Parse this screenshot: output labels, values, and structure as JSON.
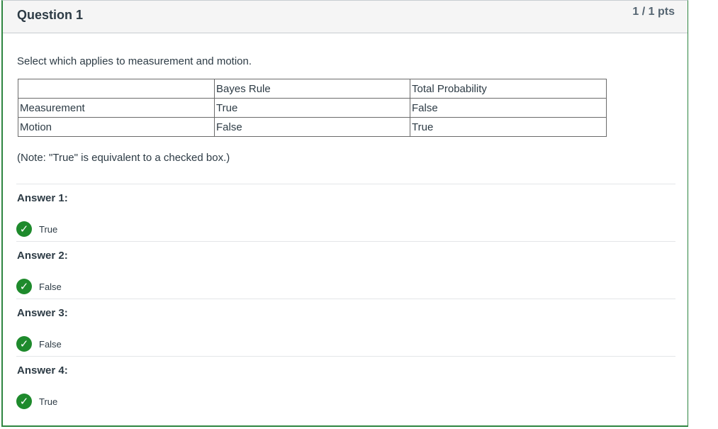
{
  "question": {
    "title": "Question 1",
    "points": "1 / 1 pts",
    "text": "Select which applies to measurement and motion.",
    "note": "(Note: \"True\" is equivalent to a checked box.)"
  },
  "table": {
    "header": [
      "",
      "Bayes Rule",
      "Total Probability"
    ],
    "rows": [
      [
        "Measurement",
        "True",
        "False"
      ],
      [
        "Motion",
        "False",
        "True"
      ]
    ]
  },
  "answers": [
    {
      "label": "Answer 1:",
      "value": "True",
      "status": "correct"
    },
    {
      "label": "Answer 2:",
      "value": "False",
      "status": "correct"
    },
    {
      "label": "Answer 3:",
      "value": "False",
      "status": "correct"
    },
    {
      "label": "Answer 4:",
      "value": "True",
      "status": "correct"
    }
  ],
  "colors": {
    "correct": "#1e8a2c",
    "border_correct": "#2e8540",
    "header_bg": "#f5f5f5"
  },
  "icons": {
    "correct": "check-icon"
  }
}
